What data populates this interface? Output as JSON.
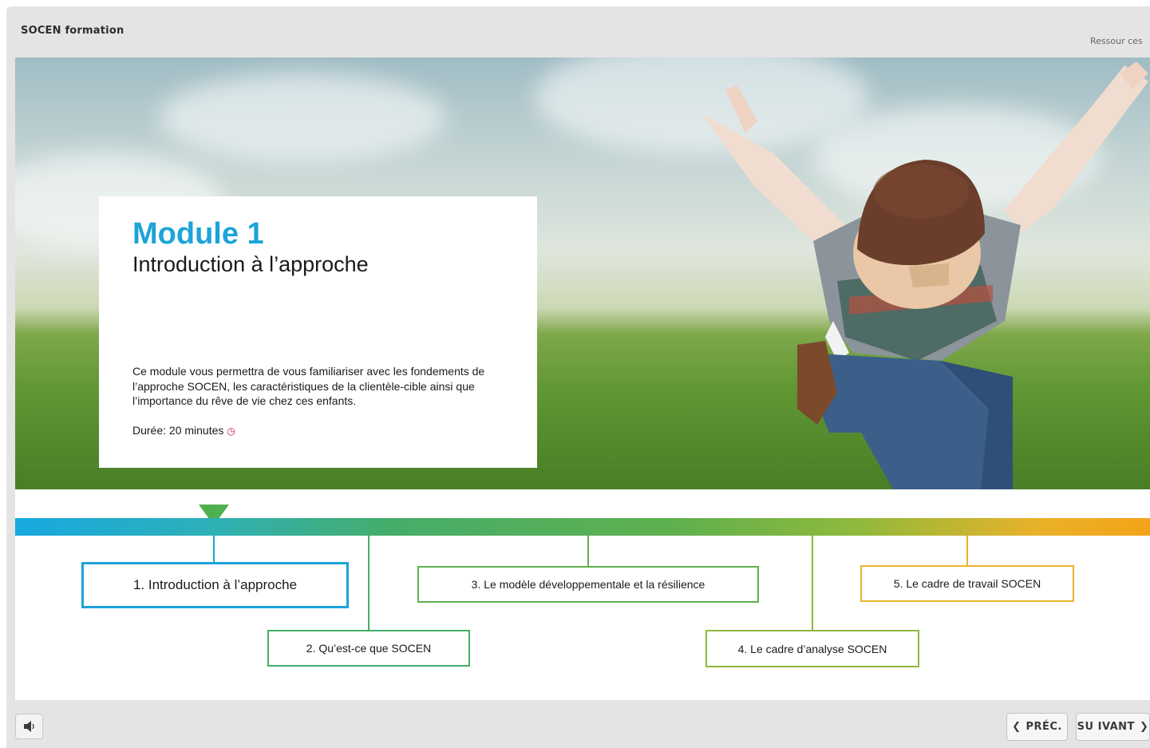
{
  "header": {
    "course_title": "SOCEN formation",
    "resources_label": "Ressour ces"
  },
  "module": {
    "title": "Module 1",
    "subtitle": "Introduction à l’approche",
    "description": "Ce module vous permettra de vous familiariser avec les fondements de l’approche SOCEN, les caractéristiques de la clientèle-cible ainsi que l’importance du rêve de vie chez ces enfants.",
    "duration": "Durée: 20 minutes"
  },
  "timeline": {
    "items": [
      {
        "label": "1. Introduction à l’approche",
        "color": "#1ba4d8",
        "active": true
      },
      {
        "label": "2. Qu’est-ce que SOCEN",
        "color": "#45ad6a"
      },
      {
        "label": "3. Le modèle développementale et la résilience",
        "color": "#5fb04e"
      },
      {
        "label": "4. Le cadre d’analyse SOCEN",
        "color": "#8fb93c"
      },
      {
        "label": "5. Le cadre de travail SOCEN",
        "color": "#e8b22a"
      }
    ]
  },
  "footer": {
    "sound_icon": "speaker-icon",
    "prev_label": "PRÉC.",
    "next_label": "SU IVANT",
    "prev_icon": "chevron-left-icon",
    "next_icon": "chevron-right-icon"
  },
  "icons": {
    "duration_icon": "clock-icon"
  }
}
